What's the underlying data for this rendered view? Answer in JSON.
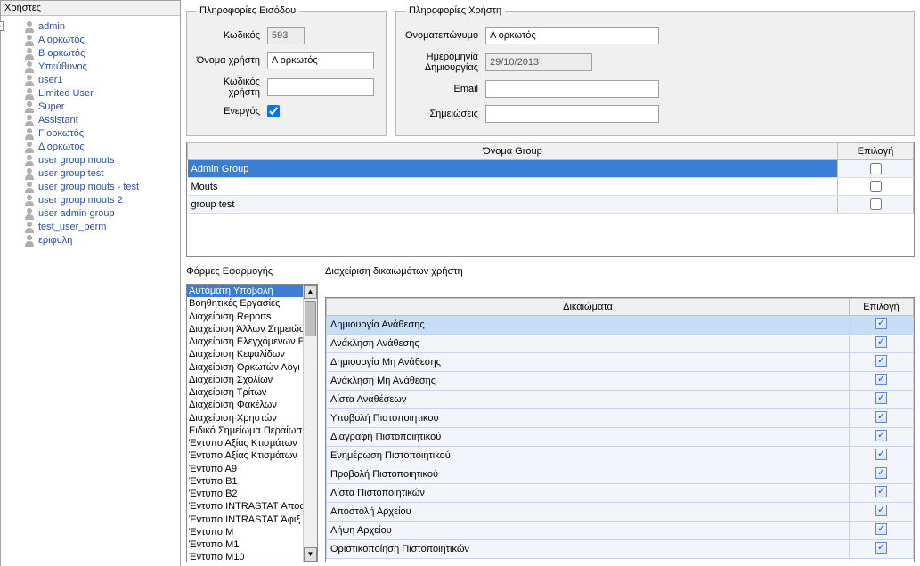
{
  "left_panel": {
    "title": "Χρήστες",
    "users": [
      "admin",
      "Α ορκωτός",
      "Β ορκωτός",
      "Υπεύθυνος",
      "user1",
      "Limited User",
      "Super",
      "Assistant",
      "Γ ορκωτός",
      "Δ ορκωτός",
      "user group mouts",
      "user group test",
      "user group mouts - test",
      "user group mouts 2",
      "user admin group",
      "test_user_perm",
      "εριφυλη"
    ]
  },
  "login_info": {
    "legend": "Πληροφορίες Εισόδου",
    "code_label": "Κωδικός",
    "code_value": "593",
    "username_label": "Όνομα χρήστη",
    "username_value": "Α ορκωτός",
    "userpw_label": "Κωδικός χρήστη",
    "userpw_value": "",
    "active_label": "Ενεργός",
    "active_value": true
  },
  "user_info": {
    "legend": "Πληροφορίες Χρήστη",
    "fullname_label": "Ονοματεπώνυμο",
    "fullname_value": "Α ορκωτός",
    "created_label": "Ημερομηνία Δημιουργίας",
    "created_value": "29/10/2013",
    "email_label": "Email",
    "email_value": "",
    "notes_label": "Σημειώσεις",
    "notes_value": ""
  },
  "groups": {
    "col_name": "Όνομα Group",
    "col_select": "Επιλογή",
    "rows": [
      {
        "name": "Admin Group",
        "selected": true,
        "checked": false
      },
      {
        "name": "Mouts",
        "selected": false,
        "checked": false
      },
      {
        "name": "group test",
        "selected": false,
        "checked": false
      }
    ]
  },
  "forms_section": {
    "header": "Φόρμες Εφαρμογής",
    "items": [
      "Αυτόματη Υποβολή",
      "Βοηθητικές Εργασίες",
      "Διαχείριση Reports",
      "Διαχείριση Άλλων Σημειώσεων",
      "Διαχείριση Ελεγχόμενων Ε",
      "Διαχείριση Κεφαλίδων",
      "Διαχείριση Ορκωτών Λογι",
      "Διαχείριση Σχολίων",
      "Διαχείριση Τρίτων",
      "Διαχείριση Φακέλων",
      "Διαχείριση Χρηστών",
      "Ειδικό Σημείωμα Περαίωσ",
      "Έντυπο  Αξίας Κτισμάτων",
      "Έντυπο  Αξίας Κτισμάτων",
      "Έντυπο Α9",
      "Έντυπο Β1",
      "Έντυπο Β2",
      "Έντυπο INTRASTAT Αποσ",
      "Έντυπο INTRASTAT Άφιξ",
      "Έντυπο Μ",
      "Έντυπο Μ1",
      "Έντυπο Μ10"
    ]
  },
  "perms_section": {
    "header": "Διαχείριση δικαιωμάτων χρήστη",
    "col_perm": "Δικαιώματα",
    "col_select": "Επιλογή",
    "rows": [
      {
        "name": "Δημιουργία Ανάθεσης",
        "checked": true,
        "selected": true
      },
      {
        "name": "Ανάκληση Ανάθεσης",
        "checked": true
      },
      {
        "name": "Δημιουργία Μη Ανάθεσης",
        "checked": true
      },
      {
        "name": "Ανάκληση Μη Ανάθεσης",
        "checked": true
      },
      {
        "name": "Λίστα Αναθέσεων",
        "checked": true
      },
      {
        "name": "Υποβολή Πιστοποιητικού",
        "checked": true
      },
      {
        "name": "Διαγραφή Πιστοποιητικού",
        "checked": true
      },
      {
        "name": "Ενημέρωση Πιστοποιητικού",
        "checked": true
      },
      {
        "name": "Προβολή Πιστοποιητικού",
        "checked": true
      },
      {
        "name": "Λίστα Πιστοποιητικών",
        "checked": true
      },
      {
        "name": "Αποστολή Αρχείου",
        "checked": true
      },
      {
        "name": "Λήψη Αρχείου",
        "checked": true
      },
      {
        "name": "Οριστικοποίηση Πιστοποιητικών",
        "checked": true
      }
    ]
  }
}
